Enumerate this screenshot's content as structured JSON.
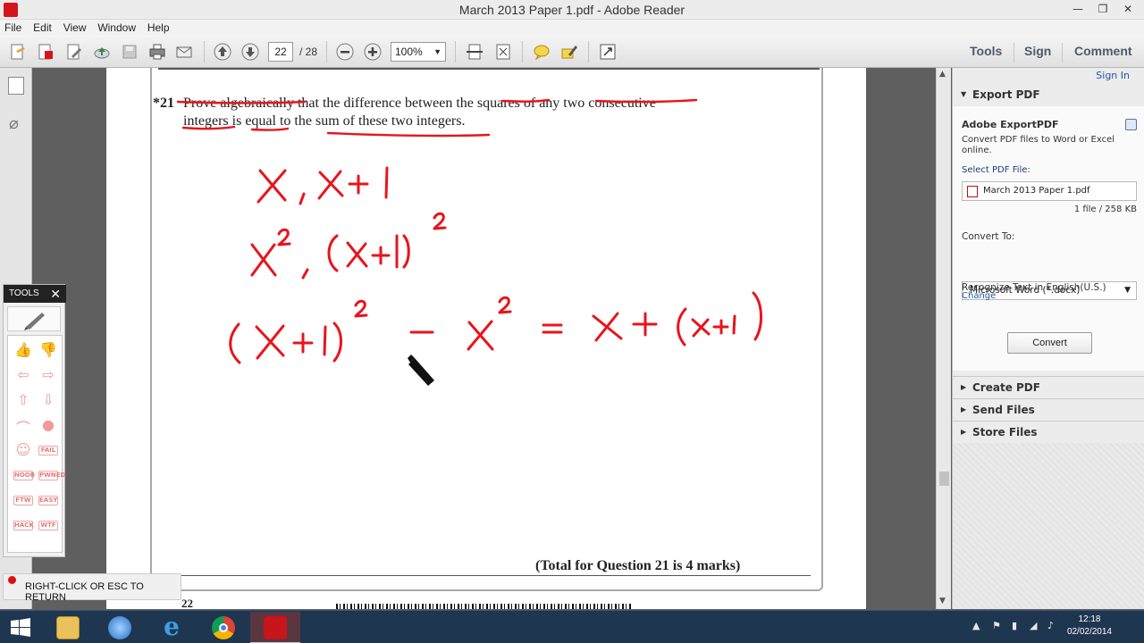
{
  "window": {
    "title": "March 2013 Paper 1.pdf - Adobe Reader"
  },
  "menu": [
    "File",
    "Edit",
    "View",
    "Window",
    "Help"
  ],
  "toolbar": {
    "page_current": "22",
    "page_total": "/ 28",
    "zoom": "100%",
    "tabs": {
      "tools": "Tools",
      "sign": "Sign",
      "comment": "Comment"
    }
  },
  "document": {
    "question_number": "*21",
    "question_line1": "Prove algebraically that the difference between the squares of any two consecutive",
    "question_line2": "integers is equal to the sum of these two integers.",
    "total_marks": "(Total for Question 21 is 4 marks)",
    "page_number": "22",
    "handwriting": {
      "line1": "X , X+1",
      "line2": "x², (x+1)²",
      "line3": "(X+1)² − X² = X + (x+1)"
    },
    "ink_color": "#e8141c"
  },
  "right_pane": {
    "sign_in": "Sign In",
    "export_pdf": "Export PDF",
    "export_title": "Adobe ExportPDF",
    "export_desc_1": "Convert PDF files to Word or Excel",
    "export_desc_2": "online.",
    "select_label": "Select PDF File:",
    "selected_file": "March 2013 Paper 1.pdf",
    "file_info": "1 file / 258 KB",
    "convert_to_label": "Convert To:",
    "convert_format": "Microsoft Word (*.docx)",
    "recognize_text": "Recognize Text in English(U.S.)",
    "change_link": "Change",
    "convert_button": "Convert",
    "create_pdf": "Create PDF",
    "send_files": "Send Files",
    "store_files": "Store Files"
  },
  "tools_palette": {
    "header": "TOOLS",
    "stamps": [
      "FAIL",
      "NOOB",
      "PWNED",
      "FTW",
      "EASY",
      "HACK",
      "WTF"
    ]
  },
  "overlay": {
    "hint": "RIGHT-CLICK OR ESC TO RETURN"
  },
  "taskbar": {
    "time": "12:18",
    "date": "02/02/2014"
  }
}
